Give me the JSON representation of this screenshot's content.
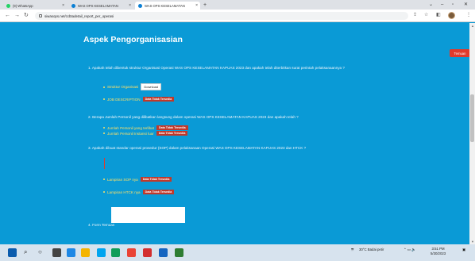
{
  "browser": {
    "tabs": [
      {
        "title": "(9) WhatsApp",
        "color": "#25d366"
      },
      {
        "title": "WAS OPS KESELAMATAN",
        "color": "#0a7fd4"
      },
      {
        "title": "WAS OPS KESELAMATAN",
        "color": "#0a7fd4"
      }
    ],
    "new_tab": "+",
    "url": "siwasops.net/ccbtadetail_report_per_operasi"
  },
  "page": {
    "title": "Aspek Pengorganisasian",
    "temuan_button": "Temuan",
    "q1": "1. Apakah telah dibentuk struktur Organisasi Operasi WAS OPS KESELAMATAN KAPUAS 2023 dan apakah telah diterbitkan surat perintah pelaksanaannya ?",
    "q1_items": [
      {
        "label": "Struktur Organisasi",
        "control": "Download"
      },
      {
        "label": "JOB DESCRIPTION",
        "control": "Data Tidak Tersedia"
      }
    ],
    "q2": "2. Berapa Jumlah Personil yang dilibatkan langsung dalam operasi WAS OPS KESELAMATAN KAPUAS 2023 dan apakah telah ?",
    "q2_items": [
      {
        "label": "Jumlah Personil yang terlibat",
        "control": "Data Tidak Tersedia"
      },
      {
        "label": "Jumlah Personil Instansi luar",
        "control": "Data Tidak Tersedia"
      }
    ],
    "q3": "3. Apakah dibuat standar operasi prosedur (SOP) dalam pelaksanaan Operasi WAS OPS KESELAMATAN KAPUAS 2023 dan HTCK ?",
    "q3_items": [
      {
        "label": "Lampiran SOP nya",
        "control": "Data Tidak Tersedia"
      },
      {
        "label": "Lampiran HTCK nya",
        "control": "Data Tidak Tersedia"
      }
    ],
    "q4": "4. Form Temuan"
  },
  "taskbar": {
    "weather": "30°C Badai petir",
    "time": "3:51 PM",
    "date": "5/30/2023"
  }
}
